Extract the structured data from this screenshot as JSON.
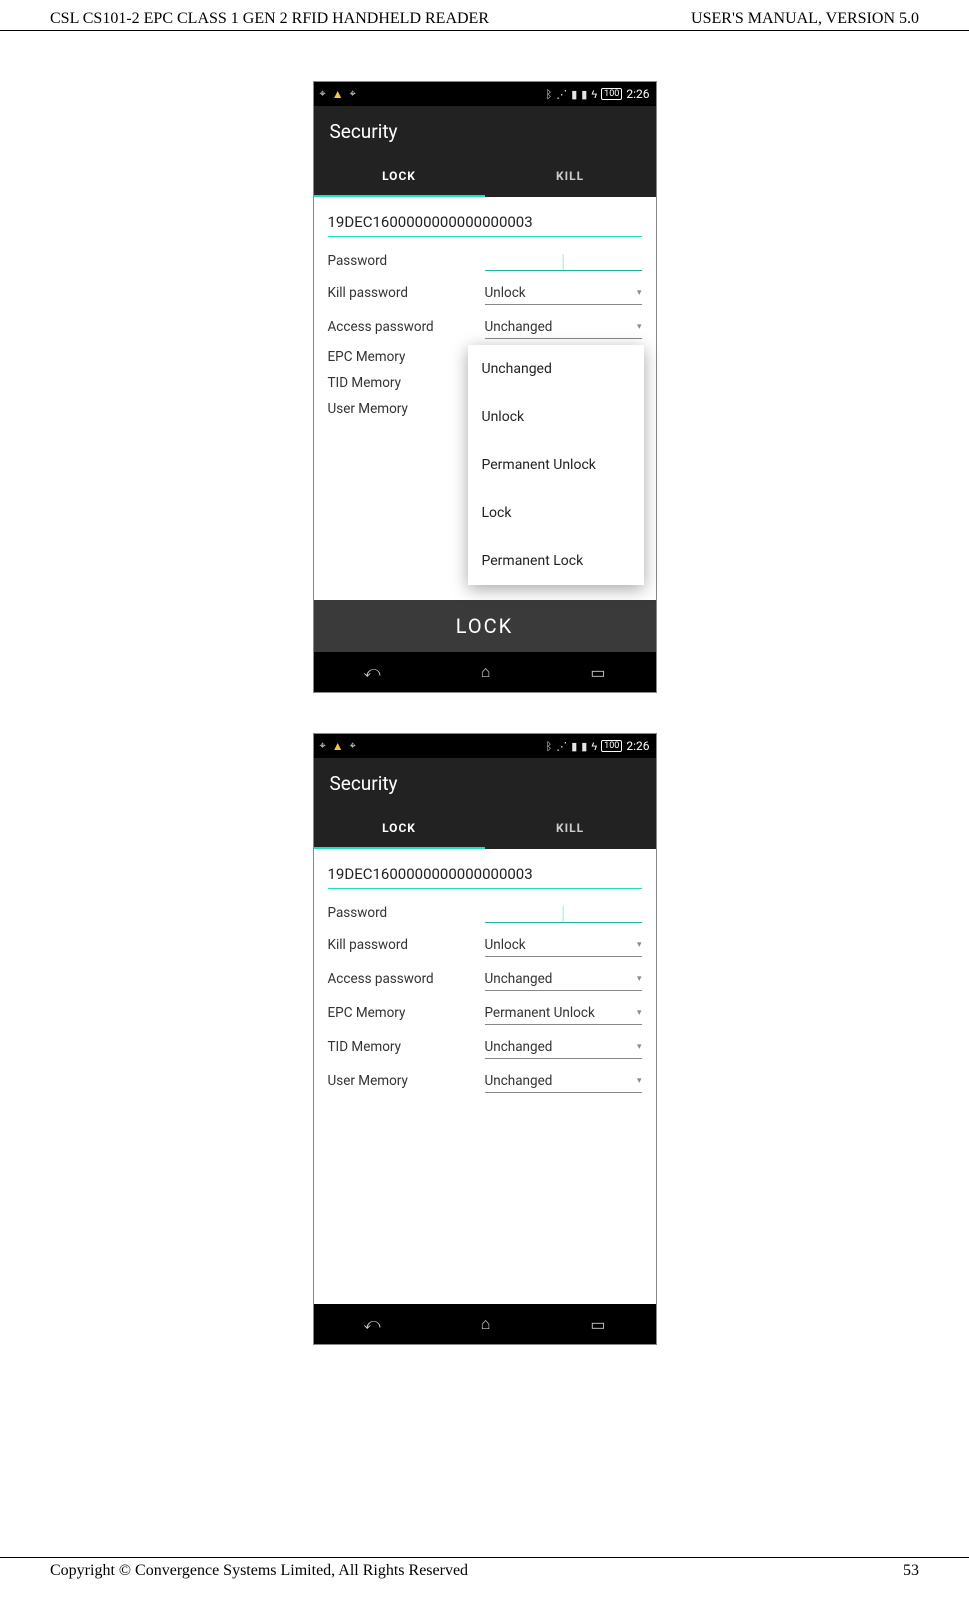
{
  "doc": {
    "header_left": "CSL CS101-2 EPC CLASS 1 GEN 2 RFID HANDHELD READER",
    "header_right": "USER'S  MANUAL,  VERSION  5.0",
    "footer_left": "Copyright © Convergence Systems Limited, All Rights Reserved",
    "footer_right": "53"
  },
  "shared": {
    "status_time": "2:26",
    "battery_pct": "100",
    "action_title": "Security",
    "tab_lock": "LOCK",
    "tab_kill": "KILL",
    "epc_value": "19DEC1600000000000000003",
    "label_password": "Password",
    "label_kill_pwd": "Kill password",
    "label_access_pwd": "Access password",
    "label_epc_mem": "EPC Memory",
    "label_tid_mem": "TID Memory",
    "label_user_mem": "User Memory",
    "big_lock_btn": "LOCK"
  },
  "screen1": {
    "val_kill_pwd": "Unlock",
    "val_access_pwd": "Unchanged",
    "popup": {
      "options": [
        "Unchanged",
        "Unlock",
        "Permanent Unlock",
        "Lock",
        "Permanent Lock"
      ]
    }
  },
  "screen2": {
    "val_kill_pwd": "Unlock",
    "val_access_pwd": "Unchanged",
    "val_epc_mem": "Permanent Unlock",
    "val_tid_mem": "Unchanged",
    "val_user_mem": "Unchanged"
  }
}
